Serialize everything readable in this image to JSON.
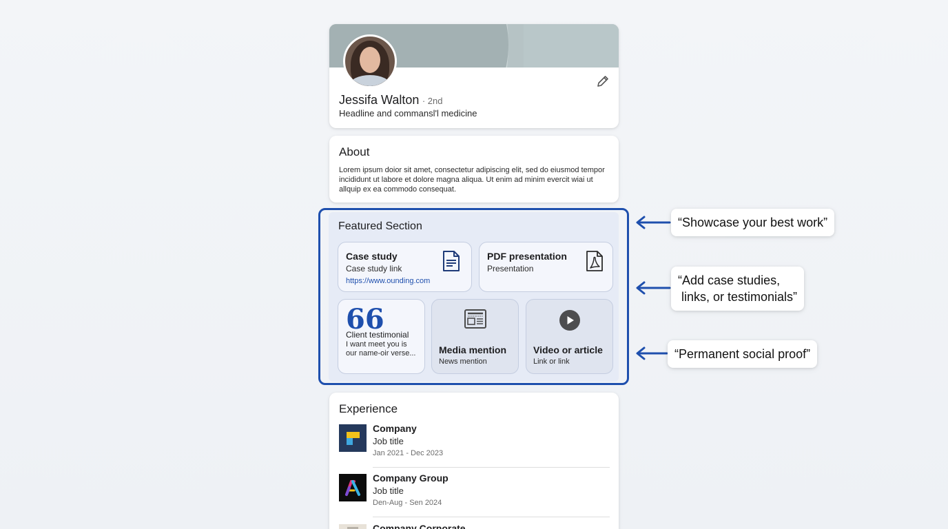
{
  "profile": {
    "name": "Jessifa Walton",
    "degree": "· 2nd",
    "headline": "Headline and commansl'l medicine",
    "edit_icon": "pencil-icon"
  },
  "about": {
    "title": "About",
    "text": "Lorem ipsum doior sit amet, consectetur adipiscing elit, sed do eiusmod tempor incididunt ut labore et dolore magna aliqua. Ut enim ad minim evercit ᴡiai ut allquip ex ea commodo consequat."
  },
  "featured": {
    "title": "Featured Section",
    "accent": "#1e4fad",
    "items": [
      {
        "title": "Case study",
        "subtitle": "Case study link",
        "link": "https://www.ounding.com",
        "icon": "document-icon"
      },
      {
        "title": "PDF presentation",
        "subtitle": "Presentation",
        "icon": "pdf-icon"
      },
      {
        "icon_text": "66",
        "title": "Client testimonial",
        "body": "I want meet you is our name-oir verse...",
        "icon": "quote-icon"
      },
      {
        "title": "Media mention",
        "subtitle": "News mention",
        "icon": "newspaper-icon"
      },
      {
        "title": "Video or article",
        "subtitle": "Link or link",
        "icon": "play-icon"
      }
    ]
  },
  "callouts": [
    "“Showcase your best work”",
    "“Add case studies,\n links, or testimonials”",
    "“Permanent social proof”"
  ],
  "experience": {
    "title": "Experience",
    "items": [
      {
        "company": "Company",
        "title": "Job title",
        "dates": "Jan 2021 - Dec 2023"
      },
      {
        "company": "Company Group",
        "title": "Job title",
        "dates": "Den-Aug - Sen 2024"
      },
      {
        "company": "Company Corporate",
        "title": "",
        "dates": ""
      }
    ]
  }
}
